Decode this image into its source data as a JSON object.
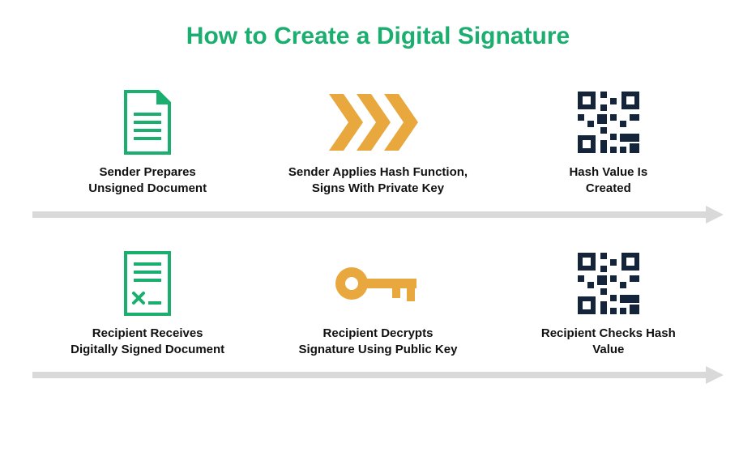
{
  "title": "How to Create a Digital Signature",
  "colors": {
    "title": "#1aae6f",
    "accent_green": "#1aae6f",
    "accent_gold": "#e9a83d",
    "dark": "#14243a",
    "arrow": "#d9d9d9"
  },
  "rows": [
    {
      "steps": [
        {
          "icon": "document-unsigned-icon",
          "label": "Sender Prepares\nUnsigned Document"
        },
        {
          "icon": "chevrons-right-icon",
          "label": "Sender Applies Hash Function,\nSigns With Private Key"
        },
        {
          "icon": "qr-hash-icon",
          "label": "Hash Value Is\nCreated"
        }
      ]
    },
    {
      "steps": [
        {
          "icon": "document-signed-icon",
          "label": "Recipient Receives\nDigitally Signed Document"
        },
        {
          "icon": "key-icon",
          "label": "Recipient Decrypts\nSignature Using Public Key"
        },
        {
          "icon": "qr-hash-icon",
          "label": "Recipient Checks Hash\nValue"
        }
      ]
    }
  ]
}
